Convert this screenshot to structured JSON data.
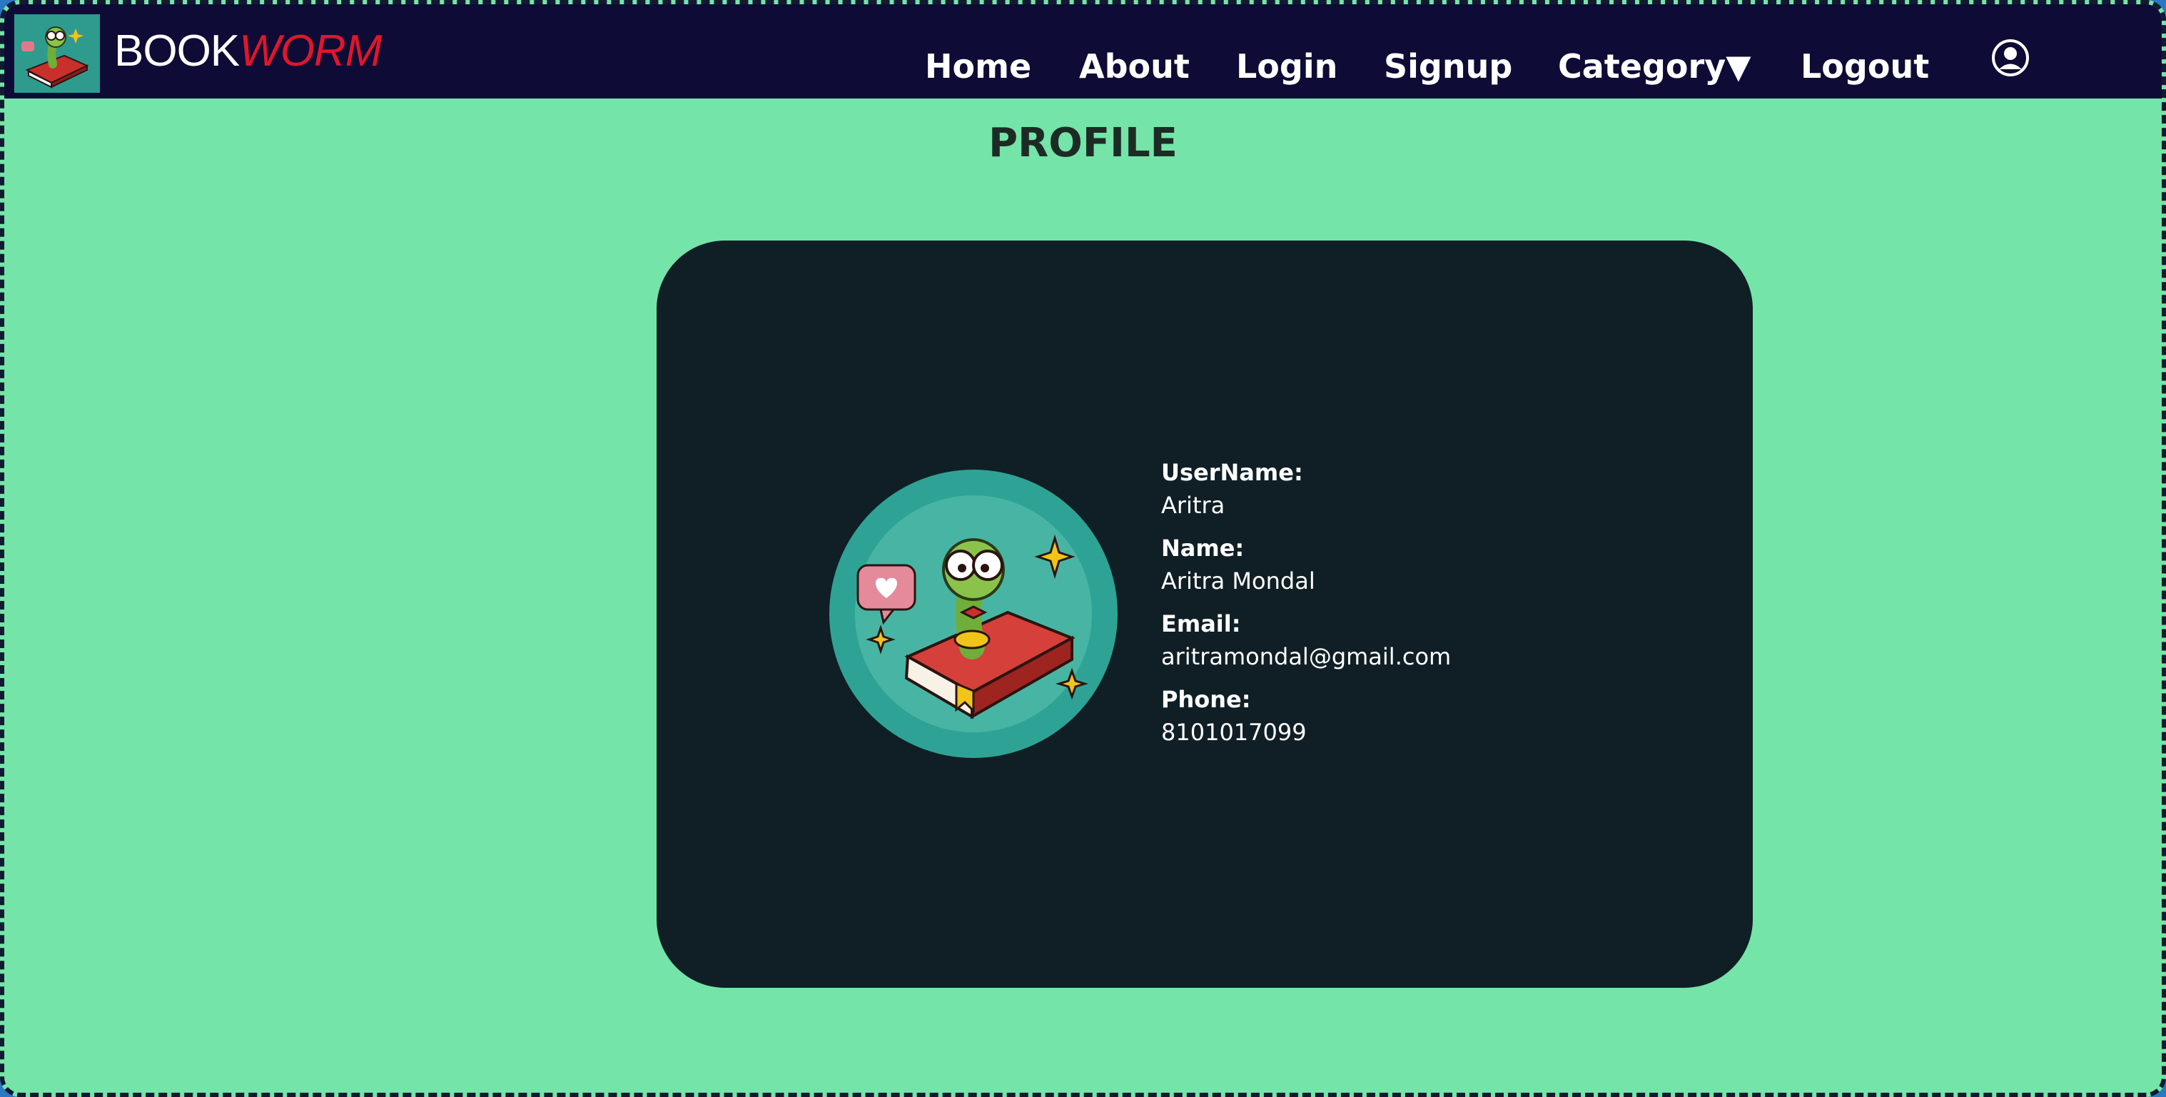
{
  "brand": {
    "part1": "BOOK",
    "part2": "WORM"
  },
  "nav": {
    "home": "Home",
    "about": "About",
    "login": "Login",
    "signup": "Signup",
    "category": "Category▼",
    "logout": "Logout"
  },
  "page": {
    "title": "PROFILE"
  },
  "profile": {
    "username_label": "UserName:",
    "username": "Aritra",
    "name_label": "Name:",
    "name": "Aritra Mondal",
    "email_label": "Email:",
    "email": "aritramondal@gmail.com",
    "phone_label": "Phone:",
    "phone": "8101017099"
  },
  "colors": {
    "navbar": "#0e0b36",
    "page_bg": "#74e4a9",
    "card_bg": "#101f25",
    "brand_accent": "#e0162b"
  },
  "icons": {
    "logo": "bookworm-logo-icon",
    "user": "user-circle-icon",
    "avatar": "bookworm-avatar-icon"
  }
}
